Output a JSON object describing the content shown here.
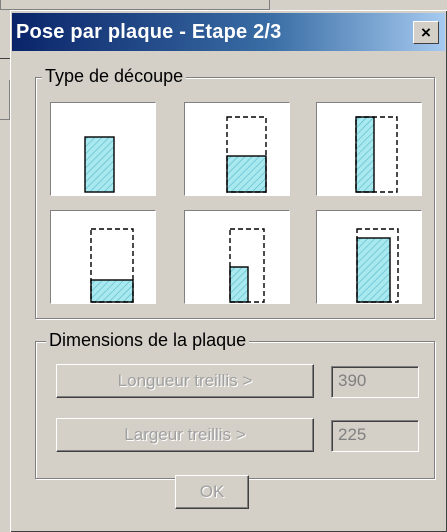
{
  "dialog": {
    "title": "Pose par plaque - Etape 2/3",
    "close_label": "×"
  },
  "type_group": {
    "label": "Type de découpe",
    "options": [
      {
        "name": "Pleine plaque partielle"
      },
      {
        "name": "Bande en bas"
      },
      {
        "name": "Bande à gauche"
      },
      {
        "name": "Petite bande en bas"
      },
      {
        "name": "Coin inférieur gauche"
      },
      {
        "name": "Grand coin inférieur gauche"
      }
    ]
  },
  "dim_group": {
    "label": "Dimensions de la plaque",
    "length_button": "Longueur treillis >",
    "length_value": "390",
    "width_button": "Largeur treillis  >",
    "width_value": "225"
  },
  "ok_label": "OK",
  "colors": {
    "hatch_fill": "#a8e8ef",
    "hatch_line": "#58b8c8",
    "title_gradient_start": "#0a246a",
    "title_gradient_end": "#a6caf0"
  }
}
